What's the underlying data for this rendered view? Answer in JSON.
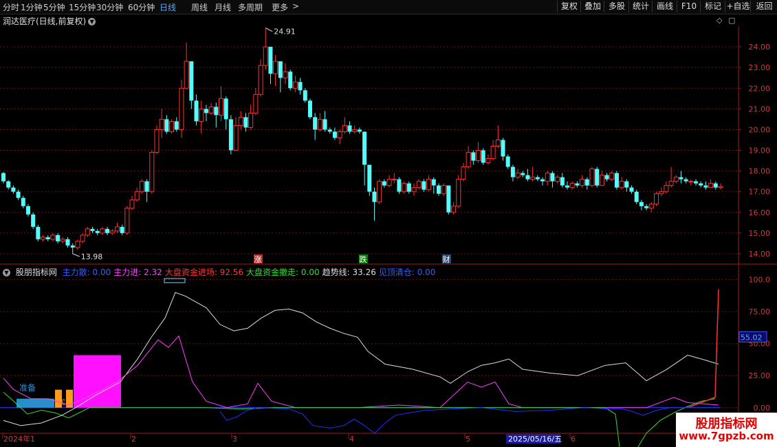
{
  "toolbar": {
    "periods": [
      "分时",
      "1分钟",
      "5分钟",
      "15分钟",
      "30分钟",
      "60分钟",
      "日线",
      "周线",
      "月线",
      "多周期",
      "更多"
    ],
    "active_period": "日线",
    "more_arrow": ">",
    "right_buttons": [
      "复权",
      "叠加",
      "多股",
      "统计",
      "画线",
      "F10",
      "标记",
      "+自选",
      "返回"
    ]
  },
  "stock": {
    "title": "润达医疗(日线,前复权)",
    "dropdown_icon": "chevron-down-icon"
  },
  "main_axis": {
    "labels": [
      "24.00",
      "23.00",
      "22.00",
      "21.00",
      "20.00",
      "19.00",
      "18.00",
      "17.00",
      "16.00",
      "15.00",
      "14.00"
    ]
  },
  "annotations": {
    "high": "24.91",
    "low": "13.98"
  },
  "markers": {
    "rise": "涨",
    "fall": "跌",
    "finance": "财"
  },
  "indicator": {
    "name": "股朋指标网",
    "items": [
      {
        "label": "主力散:",
        "value": "0.00",
        "color": "#3a5bff"
      },
      {
        "label": "主力进:",
        "value": "2.32",
        "color": "#ff40ff"
      },
      {
        "label": "大盘资金进场:",
        "value": "92.56",
        "color": "#ff3333"
      },
      {
        "label": "大盘资金撤走:",
        "value": "0.00",
        "color": "#33dd33"
      },
      {
        "label": "趋势线:",
        "value": "33.26",
        "color": "#dddddd"
      },
      {
        "label": "见顶清仓:",
        "value": "0.00",
        "color": "#3a5bff"
      }
    ],
    "axis": [
      "100.0",
      "75.00",
      "50.00",
      "25.00",
      "0.00"
    ],
    "current_value": "55.02",
    "labels": {
      "ready": "准备",
      "buy": "买入"
    }
  },
  "date_axis": {
    "labels": [
      "2024年1",
      "2",
      "3",
      "4",
      "5",
      "6"
    ],
    "cursor_date": "2025/05/16/五"
  },
  "watermark": {
    "line1": "股朋指标网",
    "line2": "www.7gpzb.com"
  },
  "chart_data": {
    "type": "candlestick",
    "title": "润达医疗(日线,前复权)",
    "ylim": [
      13.7,
      25.0
    ],
    "high_label": 24.91,
    "low_label": 13.98,
    "candles": [
      [
        17.9,
        17.5,
        17.95,
        17.4
      ],
      [
        17.5,
        17.2,
        17.55,
        17.1
      ],
      [
        17.2,
        17.0,
        17.3,
        16.9
      ],
      [
        17.0,
        16.7,
        17.1,
        16.6
      ],
      [
        16.7,
        16.3,
        16.8,
        16.2
      ],
      [
        16.3,
        15.9,
        16.4,
        15.8
      ],
      [
        15.9,
        15.3,
        16.0,
        15.2
      ],
      [
        15.3,
        14.7,
        15.4,
        14.6
      ],
      [
        14.7,
        14.8,
        14.9,
        14.6
      ],
      [
        14.8,
        14.7,
        14.9,
        14.6
      ],
      [
        14.7,
        14.9,
        15.0,
        14.6
      ],
      [
        14.9,
        14.6,
        15.0,
        14.5
      ],
      [
        14.6,
        14.7,
        14.8,
        14.5
      ],
      [
        14.7,
        14.4,
        14.8,
        14.3
      ],
      [
        14.4,
        14.3,
        14.5,
        14.0
      ],
      [
        14.3,
        14.6,
        14.7,
        14.2
      ],
      [
        14.6,
        14.9,
        15.0,
        14.5
      ],
      [
        14.9,
        15.2,
        15.3,
        14.8
      ],
      [
        15.2,
        15.1,
        15.3,
        15.0
      ],
      [
        15.1,
        15.0,
        15.2,
        14.9
      ],
      [
        15.0,
        15.2,
        15.3,
        14.9
      ],
      [
        15.2,
        15.0,
        15.3,
        14.9
      ],
      [
        15.0,
        15.1,
        15.2,
        14.9
      ],
      [
        15.1,
        15.3,
        15.5,
        15.0
      ],
      [
        15.3,
        15.0,
        15.4,
        14.9
      ],
      [
        15.0,
        16.2,
        16.3,
        14.9
      ],
      [
        16.2,
        16.6,
        16.8,
        16.1
      ],
      [
        16.6,
        17.0,
        17.2,
        16.5
      ],
      [
        17.0,
        17.5,
        17.6,
        16.9
      ],
      [
        17.5,
        17.0,
        17.6,
        16.5
      ],
      [
        17.0,
        18.9,
        19.0,
        16.9
      ],
      [
        18.9,
        20.0,
        20.2,
        18.8
      ],
      [
        20.0,
        20.5,
        21.0,
        19.6
      ],
      [
        20.5,
        19.9,
        20.7,
        19.8
      ],
      [
        19.9,
        20.4,
        20.5,
        19.8
      ],
      [
        20.4,
        20.0,
        20.6,
        19.9
      ],
      [
        20.0,
        22.0,
        22.4,
        19.6
      ],
      [
        22.0,
        23.3,
        24.2,
        22.3
      ],
      [
        23.3,
        21.4,
        22.6,
        21.0
      ],
      [
        21.4,
        20.4,
        21.7,
        20.2
      ],
      [
        20.4,
        21.0,
        21.4,
        19.8
      ],
      [
        21.0,
        20.8,
        21.2,
        20.4
      ],
      [
        20.8,
        21.1,
        21.3,
        20.7
      ],
      [
        21.1,
        20.7,
        21.3,
        20.1
      ],
      [
        20.7,
        21.5,
        22.1,
        20.4
      ],
      [
        21.5,
        20.5,
        21.6,
        20.0
      ],
      [
        20.5,
        19.0,
        20.7,
        18.8
      ],
      [
        19.0,
        20.2,
        20.6,
        19.0
      ],
      [
        20.2,
        20.6,
        20.9,
        20.0
      ],
      [
        20.6,
        20.1,
        20.8,
        19.9
      ],
      [
        20.1,
        20.8,
        21.2,
        20.0
      ],
      [
        20.8,
        21.7,
        22.0,
        20.7
      ],
      [
        21.7,
        23.1,
        23.4,
        21.6
      ],
      [
        23.1,
        24.0,
        24.91,
        22.9
      ],
      [
        24.0,
        22.7,
        23.6,
        22.2
      ],
      [
        22.7,
        23.3,
        23.6,
        22.1
      ],
      [
        23.3,
        22.5,
        23.0,
        21.8
      ],
      [
        22.5,
        22.8,
        23.2,
        22.2
      ],
      [
        22.8,
        22.0,
        22.9,
        21.9
      ],
      [
        22.0,
        22.3,
        22.6,
        21.8
      ],
      [
        22.3,
        21.9,
        22.5,
        21.7
      ],
      [
        21.9,
        21.4,
        22.0,
        21.3
      ],
      [
        21.4,
        20.6,
        21.5,
        20.5
      ],
      [
        20.6,
        20.0,
        20.8,
        19.5
      ],
      [
        20.0,
        20.5,
        20.8,
        19.9
      ],
      [
        20.5,
        20.0,
        20.9,
        19.9
      ],
      [
        20.0,
        19.9,
        20.1,
        19.8
      ],
      [
        19.9,
        19.6,
        20.1,
        19.5
      ],
      [
        19.6,
        19.9,
        20.0,
        19.3
      ],
      [
        19.9,
        20.2,
        20.6,
        19.8
      ],
      [
        20.2,
        19.9,
        20.4,
        19.8
      ],
      [
        19.9,
        20.0,
        20.2,
        19.8
      ],
      [
        20.0,
        19.9,
        20.1,
        19.8
      ],
      [
        19.9,
        18.3,
        18.8,
        17.3
      ],
      [
        18.3,
        17.0,
        18.2,
        16.8
      ],
      [
        17.0,
        16.5,
        17.2,
        15.6
      ],
      [
        16.5,
        17.5,
        17.6,
        16.4
      ],
      [
        17.5,
        17.3,
        17.6,
        17.2
      ],
      [
        17.3,
        17.6,
        17.8,
        17.2
      ],
      [
        17.6,
        17.6,
        17.9,
        17.4
      ],
      [
        17.6,
        17.0,
        17.7,
        16.9
      ],
      [
        17.0,
        17.4,
        17.5,
        16.9
      ],
      [
        17.4,
        17.0,
        17.5,
        16.9
      ],
      [
        17.0,
        17.2,
        17.4,
        16.8
      ],
      [
        17.2,
        17.5,
        17.6,
        17.1
      ],
      [
        17.5,
        17.1,
        17.6,
        17.0
      ],
      [
        17.1,
        17.6,
        17.8,
        17.0
      ],
      [
        17.6,
        17.3,
        17.7,
        16.9
      ],
      [
        17.3,
        16.9,
        17.4,
        16.8
      ],
      [
        16.9,
        17.3,
        17.4,
        16.8
      ],
      [
        17.3,
        16.0,
        16.8,
        15.9
      ],
      [
        16.0,
        16.3,
        16.5,
        15.9
      ],
      [
        16.3,
        17.6,
        17.8,
        16.2
      ],
      [
        17.6,
        18.2,
        18.4,
        17.5
      ],
      [
        18.2,
        18.9,
        19.2,
        18.1
      ],
      [
        18.9,
        18.5,
        19.0,
        18.3
      ],
      [
        18.5,
        19.0,
        19.4,
        18.4
      ],
      [
        19.0,
        18.4,
        19.1,
        18.3
      ],
      [
        18.4,
        18.6,
        18.8,
        18.3
      ],
      [
        18.6,
        19.2,
        19.5,
        18.5
      ],
      [
        19.2,
        19.5,
        20.2,
        19.1
      ],
      [
        19.5,
        18.7,
        19.6,
        18.5
      ],
      [
        18.7,
        18.2,
        18.8,
        18.1
      ],
      [
        18.2,
        17.7,
        18.3,
        17.5
      ],
      [
        17.7,
        17.9,
        18.1,
        17.6
      ],
      [
        17.9,
        17.8,
        18.0,
        17.7
      ],
      [
        17.8,
        17.6,
        18.1,
        17.5
      ],
      [
        17.6,
        17.7,
        18.2,
        17.5
      ],
      [
        17.7,
        17.6,
        17.8,
        17.5
      ],
      [
        17.6,
        17.5,
        17.7,
        17.3
      ],
      [
        17.5,
        17.9,
        18.0,
        17.3
      ],
      [
        17.9,
        17.5,
        18.0,
        17.2
      ],
      [
        17.5,
        17.7,
        17.8,
        17.4
      ],
      [
        17.7,
        17.3,
        17.9,
        17.2
      ],
      [
        17.3,
        17.2,
        17.5,
        17.1
      ],
      [
        17.2,
        17.4,
        17.5,
        17.1
      ],
      [
        17.4,
        17.3,
        17.5,
        17.2
      ],
      [
        17.3,
        17.6,
        17.8,
        17.2
      ],
      [
        17.6,
        17.3,
        17.7,
        17.1
      ],
      [
        17.3,
        18.1,
        18.2,
        17.2
      ],
      [
        18.1,
        17.3,
        18.2,
        17.2
      ],
      [
        17.3,
        17.8,
        18.0,
        17.3
      ],
      [
        17.8,
        17.6,
        17.9,
        17.5
      ],
      [
        17.6,
        17.9,
        18.0,
        17.5
      ],
      [
        17.9,
        17.2,
        18.0,
        17.1
      ],
      [
        17.2,
        17.5,
        17.7,
        17.1
      ],
      [
        17.5,
        17.2,
        17.6,
        17.0
      ],
      [
        17.2,
        17.0,
        17.3,
        16.9
      ],
      [
        17.0,
        16.5,
        17.1,
        16.4
      ],
      [
        16.5,
        16.3,
        16.6,
        16.1
      ],
      [
        16.3,
        16.2,
        16.4,
        16.1
      ],
      [
        16.2,
        16.4,
        16.5,
        16.0
      ],
      [
        16.4,
        16.9,
        17.0,
        16.3
      ],
      [
        16.9,
        17.0,
        17.2,
        16.8
      ],
      [
        17.0,
        17.3,
        17.5,
        16.9
      ],
      [
        17.3,
        17.5,
        18.2,
        17.2
      ],
      [
        17.5,
        17.7,
        17.8,
        17.4
      ],
      [
        17.7,
        17.6,
        18.0,
        17.4
      ],
      [
        17.6,
        17.5,
        17.7,
        17.4
      ],
      [
        17.5,
        17.5,
        17.6,
        17.3
      ],
      [
        17.5,
        17.4,
        17.6,
        17.3
      ],
      [
        17.4,
        17.3,
        17.5,
        17.2
      ],
      [
        17.3,
        17.2,
        17.5,
        17.1
      ],
      [
        17.2,
        17.4,
        17.6,
        17.2
      ],
      [
        17.4,
        17.2,
        17.5,
        17.1
      ],
      [
        17.2,
        17.25,
        17.4,
        17.1
      ]
    ],
    "indicator_panel": {
      "ylim": [
        -20,
        110
      ],
      "trend_line_last": 33.26,
      "big_money_in_last": 92.56,
      "main_in_last": 2.32,
      "marked_value": 55.02
    }
  }
}
